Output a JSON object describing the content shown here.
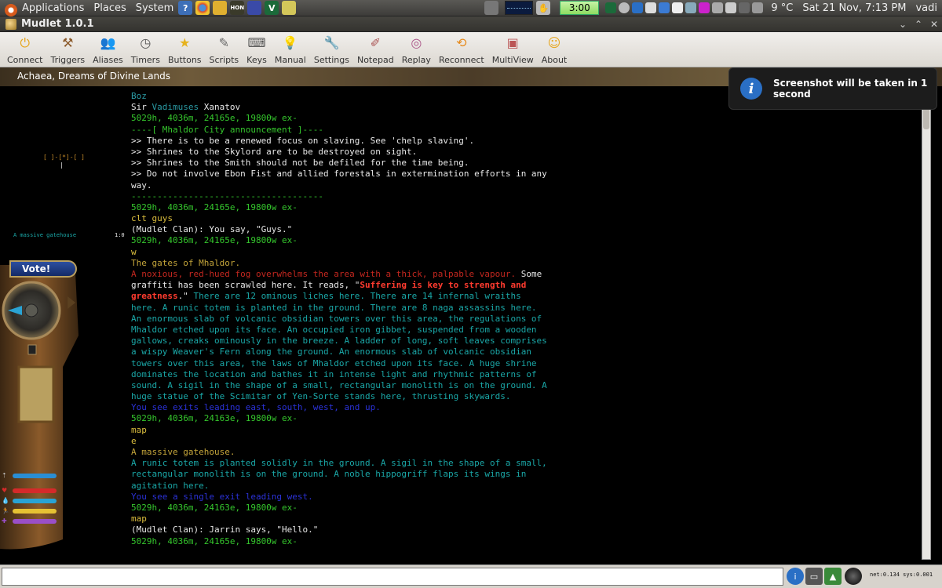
{
  "panel": {
    "menus": [
      "Applications",
      "Places",
      "System"
    ],
    "clock_widget": "3:00",
    "weather": "9 °C",
    "datetime": "Sat 21 Nov,  7:13 PM",
    "user": "vadi"
  },
  "window": {
    "title": "Mudlet 1.0.1"
  },
  "toolbar": [
    {
      "label": "Connect",
      "icon": "connect-icon"
    },
    {
      "label": "Triggers",
      "icon": "triggers-icon"
    },
    {
      "label": "Aliases",
      "icon": "aliases-icon"
    },
    {
      "label": "Timers",
      "icon": "timers-icon"
    },
    {
      "label": "Buttons",
      "icon": "buttons-icon"
    },
    {
      "label": "Scripts",
      "icon": "scripts-icon"
    },
    {
      "label": "Keys",
      "icon": "keys-icon"
    },
    {
      "label": "Manual",
      "icon": "manual-icon"
    },
    {
      "label": "Settings",
      "icon": "settings-icon"
    },
    {
      "label": "Notepad",
      "icon": "notepad-icon"
    },
    {
      "label": "Replay",
      "icon": "replay-icon"
    },
    {
      "label": "Reconnect",
      "icon": "reconnect-icon"
    },
    {
      "label": "MultiView",
      "icon": "multiview-icon"
    },
    {
      "label": "About",
      "icon": "about-icon"
    }
  ],
  "banner": "Achaea, Dreams of Divine Lands",
  "map": {
    "room_marker": "[ ]-[*]-[ ]",
    "room_name": "A massive gatehouse",
    "coords": "1:0",
    "vote_label": "Vote!"
  },
  "notification": "Screenshot will be taken in 1 second",
  "console": [
    [
      {
        "t": "Boz",
        "c": "cy"
      }
    ],
    [
      {
        "t": "Sir ",
        "c": "wh"
      },
      {
        "t": "Vadimuses",
        "c": "cy"
      },
      {
        "t": " Xanatov",
        "c": "wh"
      }
    ],
    [
      {
        "t": "5029h, 4036m, 24165e, 19800w ex-",
        "c": "gr"
      }
    ],
    [
      {
        "t": "----[ Mhaldor City announcement ]----",
        "c": "gr"
      }
    ],
    [
      {
        "t": ">> There is to be a renewed focus on slaving. See 'chelp slaving'.",
        "c": "wh"
      }
    ],
    [
      {
        "t": ">> Shrines to the Skylord are to be destroyed on sight.",
        "c": "wh"
      }
    ],
    [
      {
        "t": ">> Shrines to the Smith should not be defiled for the time being.",
        "c": "wh"
      }
    ],
    [
      {
        "t": ">> Do not involve Ebon Fist and allied forestals in extermination efforts in any",
        "c": "wh"
      }
    ],
    [
      {
        "t": "way.",
        "c": "wh"
      }
    ],
    [
      {
        "t": "-------------------------------------",
        "c": "gr"
      }
    ],
    [
      {
        "t": "5029h, 4036m, 24165e, 19800w ex-",
        "c": "gr"
      }
    ],
    [
      {
        "t": "clt guys",
        "c": "ye"
      }
    ],
    [
      {
        "t": "(Mudlet Clan): You say, \"Guys.\"",
        "c": "wh"
      }
    ],
    [
      {
        "t": "5029h, 4036m, 24165e, 19800w ex-",
        "c": "gr"
      }
    ],
    [
      {
        "t": "w",
        "c": "ye"
      }
    ],
    [
      {
        "t": "The gates of Mhaldor.",
        "c": "bn"
      }
    ],
    [
      {
        "t": "A noxious, red-hued fog overwhelms the area with a thick, palpable vapour.",
        "c": "rd"
      },
      {
        "t": " Some",
        "c": "wh"
      }
    ],
    [
      {
        "t": "graffiti has been scrawled here. It reads, \"",
        "c": "wh"
      },
      {
        "t": "Suffering is key to strength and",
        "c": "rb"
      }
    ],
    [
      {
        "t": "greatness",
        "c": "rb"
      },
      {
        "t": ".\"",
        "c": "wh"
      },
      {
        "t": " There are 12 ominous liches here. There are 14 infernal wraiths",
        "c": "tl"
      }
    ],
    [
      {
        "t": "here. A runic totem is planted in the ground. There are 8 naga assassins here.",
        "c": "tl"
      }
    ],
    [
      {
        "t": "An enormous slab of volcanic obsidian towers over this area, the regulations of",
        "c": "tl"
      }
    ],
    [
      {
        "t": "Mhaldor etched upon its face. An occupied iron gibbet, suspended from a wooden",
        "c": "tl"
      }
    ],
    [
      {
        "t": "gallows, creaks ominously in the breeze. A ladder of long, soft leaves comprises",
        "c": "tl"
      }
    ],
    [
      {
        "t": "a wispy Weaver's Fern along the ground. An enormous slab of volcanic obsidian",
        "c": "tl"
      }
    ],
    [
      {
        "t": "towers over this area, the laws of Mhaldor etched upon its face. A huge shrine",
        "c": "tl"
      }
    ],
    [
      {
        "t": "dominates the location and bathes it in intense light and rhythmic patterns of",
        "c": "tl"
      }
    ],
    [
      {
        "t": "sound. A sigil in the shape of a small, rectangular monolith is on the ground. A",
        "c": "tl"
      }
    ],
    [
      {
        "t": "huge statue of the Scimitar of Yen-Sorte stands here, thrusting skywards.",
        "c": "tl"
      }
    ],
    [
      {
        "t": "You see exits leading east, south, west, and up.",
        "c": "bl"
      }
    ],
    [
      {
        "t": "5029h, 4036m, 24163e, 19800w ex-",
        "c": "gr"
      }
    ],
    [
      {
        "t": "map",
        "c": "ye"
      }
    ],
    [
      {
        "t": "e",
        "c": "ye"
      }
    ],
    [
      {
        "t": "A massive gatehouse.",
        "c": "bn"
      }
    ],
    [
      {
        "t": "A runic totem is planted solidly in the ground. A sigil in the shape of a small,",
        "c": "tl"
      }
    ],
    [
      {
        "t": "rectangular monolith is on the ground. A noble hippogriff flaps its wings in",
        "c": "tl"
      }
    ],
    [
      {
        "t": "agitation here.",
        "c": "tl"
      }
    ],
    [
      {
        "t": "You see a single exit leading west.",
        "c": "bl"
      }
    ],
    [
      {
        "t": "5029h, 4036m, 24163e, 19800w ex-",
        "c": "gr"
      }
    ],
    [
      {
        "t": "map",
        "c": "ye"
      }
    ],
    [
      {
        "t": "(Mudlet Clan): Jarrin says, \"Hello.\"",
        "c": "wh"
      }
    ],
    [
      {
        "t": "5029h, 4036m, 24165e, 19800w ex-",
        "c": "gr"
      }
    ]
  ],
  "command_input": {
    "value": "",
    "placeholder": ""
  },
  "status": {
    "netsys": "net:0.134 sys:0.001"
  },
  "colors": {
    "prompt": "#35c72d",
    "room_desc": "#1aa7a7",
    "exits": "#2b32d9",
    "room_title": "#c3a43a",
    "echo": "#dcbf3e",
    "fog": "#c4271f",
    "graffiti": "#ff3b2f",
    "gauge_health": "#d42a2a",
    "gauge_mana": "#2aa3d4",
    "gauge_endurance": "#e6c233",
    "gauge_willpower": "#9a4fc8"
  }
}
